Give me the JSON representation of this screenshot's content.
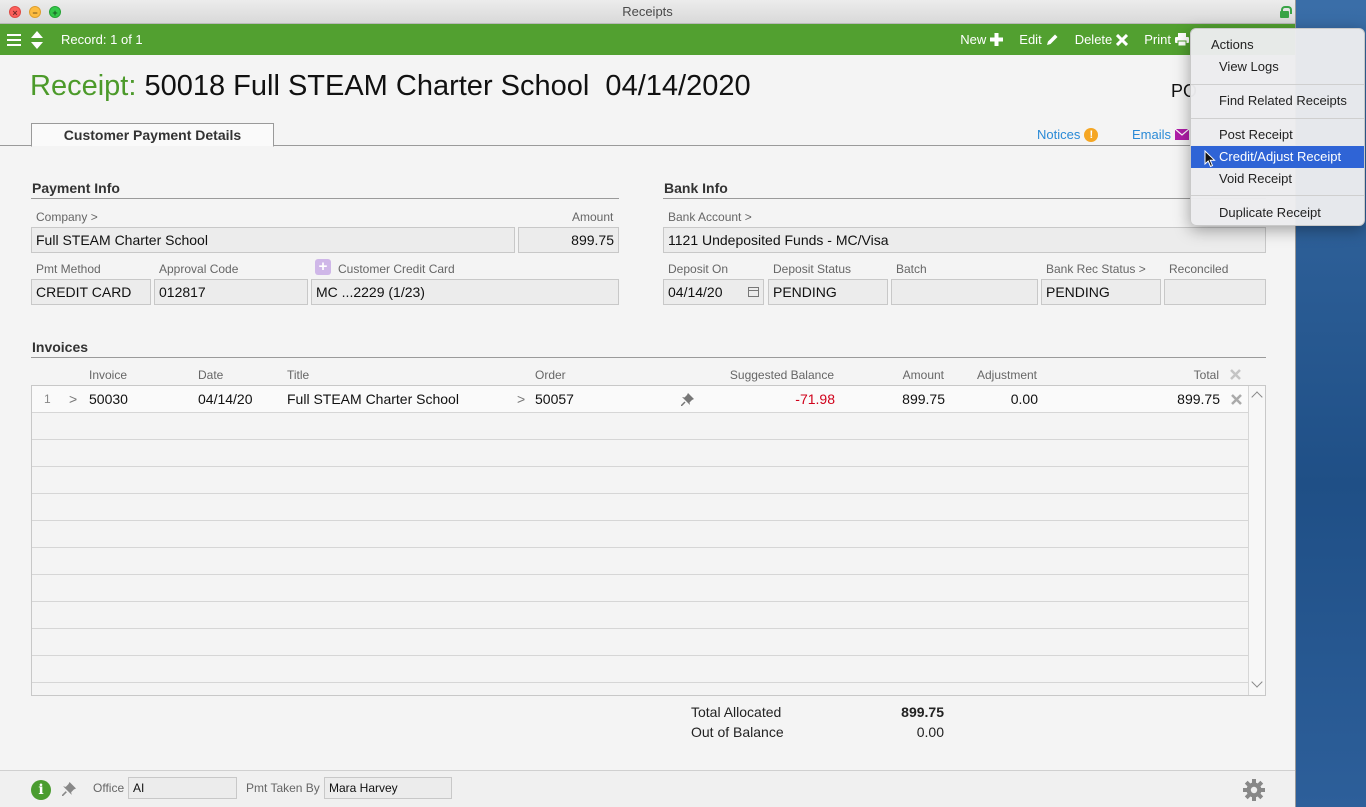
{
  "window": {
    "title": "Receipts"
  },
  "toolbar": {
    "record": "Record: 1 of 1",
    "new_label": "New",
    "edit_label": "Edit",
    "delete_label": "Delete",
    "print_label": "Print"
  },
  "header": {
    "label": "Receipt:",
    "title": "50018 Full STEAM Charter School  04/14/2020",
    "po_fragment": "PO"
  },
  "tabs": {
    "active": "Customer Payment Details",
    "notices": "Notices",
    "emails": "Emails"
  },
  "payment_info": {
    "title": "Payment Info",
    "company_label": "Company >",
    "company": "Full STEAM Charter School",
    "amount_label": "Amount",
    "amount": "899.75",
    "pmt_method_label": "Pmt Method",
    "pmt_method": "CREDIT CARD",
    "approval_label": "Approval Code",
    "approval": "012817",
    "card_label": "Customer Credit Card",
    "card": "MC ...2229 (1/23)"
  },
  "bank_info": {
    "title": "Bank Info",
    "account_label": "Bank Account >",
    "account": "1121 Undeposited Funds - MC/Visa",
    "deposit_on_label": "Deposit On",
    "deposit_on": "04/14/20",
    "deposit_status_label": "Deposit Status",
    "deposit_status": "PENDING",
    "batch_label": "Batch",
    "batch": "",
    "bank_rec_label": "Bank Rec Status >",
    "bank_rec": "PENDING",
    "reconciled_label": "Reconciled",
    "reconciled": ""
  },
  "invoices": {
    "title": "Invoices",
    "columns": {
      "invoice": "Invoice",
      "date": "Date",
      "title": "Title",
      "order": "Order",
      "suggested": "Suggested Balance",
      "amount": "Amount",
      "adjustment": "Adjustment",
      "total": "Total"
    },
    "rows": [
      {
        "num": "1",
        "invoice": "50030",
        "date": "04/14/20",
        "title": "Full STEAM Charter School",
        "order": "50057",
        "suggested": "-71.98",
        "amount": "899.75",
        "adjustment": "0.00",
        "total": "899.75"
      }
    ]
  },
  "totals": {
    "allocated_label": "Total Allocated",
    "allocated": "899.75",
    "out_label": "Out of Balance",
    "out": "0.00"
  },
  "footer": {
    "office_label": "Office",
    "office": "AI",
    "taken_by_label": "Pmt Taken By",
    "taken_by": "Mara Harvey"
  },
  "menu": {
    "header": "Actions",
    "items": {
      "view_logs": "View Logs",
      "find_related": "Find Related Receipts",
      "post": "Post Receipt",
      "credit_adjust": "Credit/Adjust Receipt",
      "void": "Void Receipt",
      "duplicate": "Duplicate Receipt"
    }
  },
  "colors": {
    "toolbar_green": "#52a030",
    "label_green": "#4c9a2a",
    "link_blue": "#2a8ad6",
    "negative_red": "#d0021b",
    "menu_highlight": "#2f64d6"
  }
}
